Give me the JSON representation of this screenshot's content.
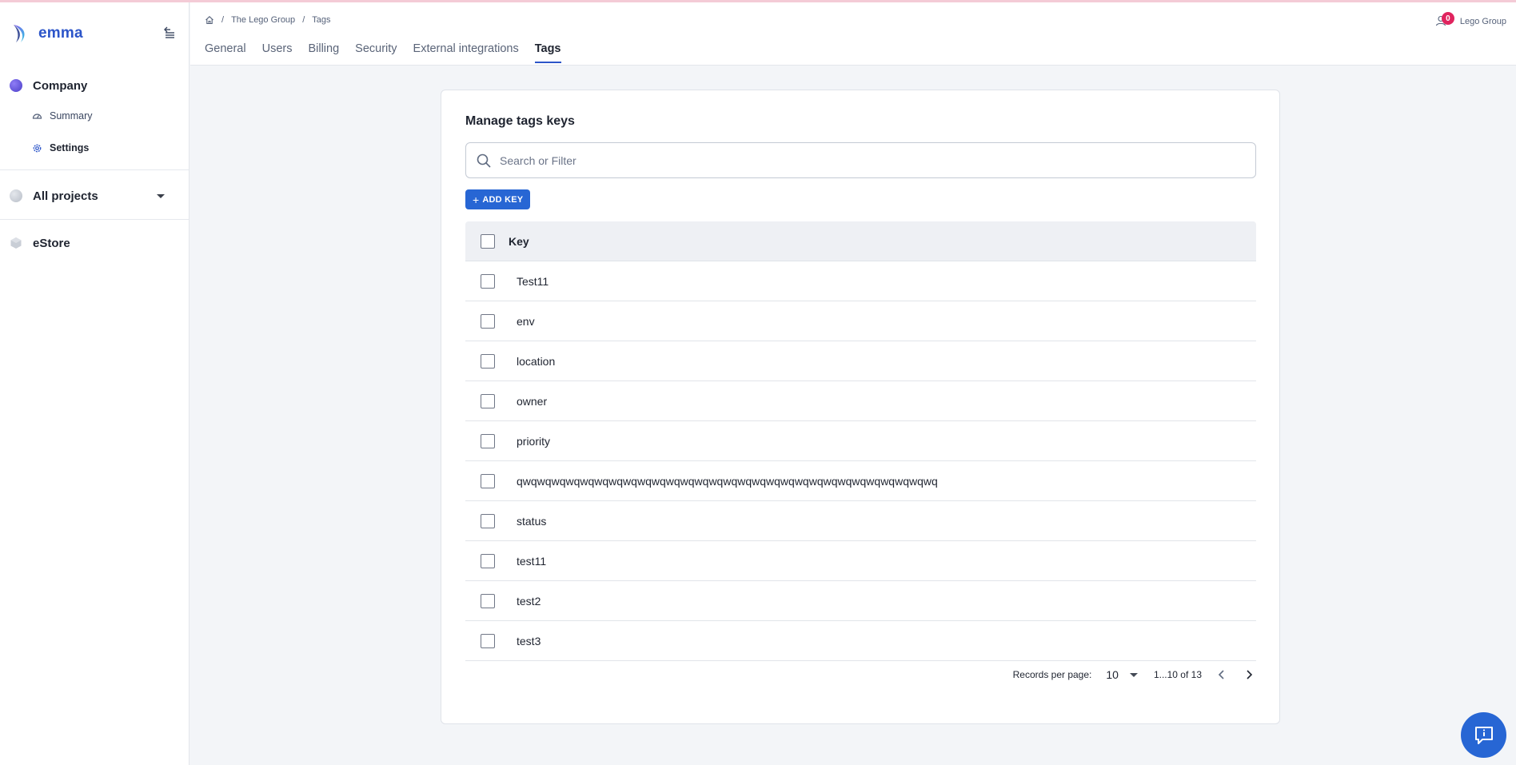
{
  "app": {
    "name": "emma"
  },
  "sidebar": {
    "company": {
      "label": "Company"
    },
    "items": [
      {
        "label": "Summary"
      },
      {
        "label": "Settings"
      }
    ],
    "all_projects": {
      "label": "All projects"
    },
    "estore": {
      "label": "eStore"
    }
  },
  "header": {
    "breadcrumb": [
      "The Lego Group",
      "Tags"
    ],
    "tabs": [
      "General",
      "Users",
      "Billing",
      "Security",
      "External integrations",
      "Tags"
    ],
    "active_tab": "Tags",
    "notification_count": "0",
    "org_name": "Lego Group"
  },
  "card": {
    "title": "Manage tags keys",
    "search_placeholder": "Search or Filter",
    "add_button": "ADD KEY",
    "column_header": "Key",
    "rows": [
      "Test11",
      "env",
      "location",
      "owner",
      "priority",
      "qwqwqwqwqwqwqwqwqwqwqwqwqwqwqwqwqwqwqwqwqwqwqwqwqwqwqwqwqwq",
      "status",
      "test11",
      "test2",
      "test3"
    ]
  },
  "pagination": {
    "records_label": "Records per page:",
    "per_page": "10",
    "range": "1...10 of 13"
  },
  "colors": {
    "accent": "#2766d4",
    "brand": "#2c55c9",
    "badge": "#e0245e"
  }
}
